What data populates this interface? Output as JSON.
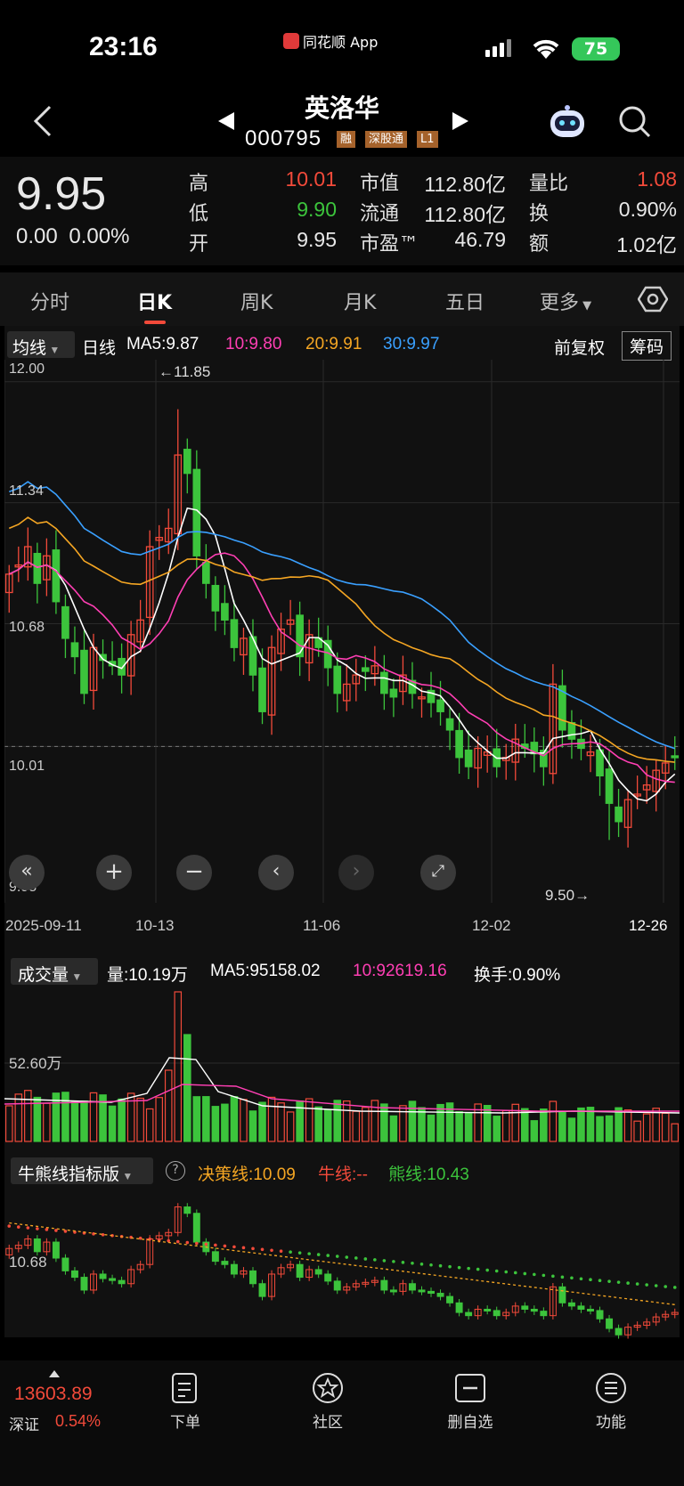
{
  "status_bar": {
    "time": "23:16",
    "app": "同花顺 App",
    "battery": "75"
  },
  "header": {
    "name": "英洛华",
    "code": "000795",
    "tags": [
      "融",
      "深股通",
      "L1"
    ]
  },
  "quote": {
    "price": "9.95",
    "change": "0.00",
    "change_pct": "0.00%",
    "high_label": "高",
    "high": "10.01",
    "low_label": "低",
    "low": "9.90",
    "open_label": "开",
    "open": "9.95",
    "mktcap_label": "市值",
    "mktcap": "112.80亿",
    "float_label": "流通",
    "float": "112.80亿",
    "pe_label": "市盈™",
    "pe": "46.79",
    "vr_label": "量比",
    "vr": "1.08",
    "turnover_label": "换",
    "turnover": "0.90%",
    "amount_label": "额",
    "amount": "1.02亿"
  },
  "tabs": [
    "分时",
    "日K",
    "周K",
    "月K",
    "五日",
    "更多"
  ],
  "ma_bar": {
    "selector": "均线",
    "period": "日线",
    "ma5": "MA5:9.87",
    "ma10": "10:9.80",
    "ma20": "20:9.91",
    "ma30": "30:9.97",
    "adjust": "前复权",
    "chips": "筹码"
  },
  "kline": {
    "y_labels": [
      "12.00",
      "11.34",
      "10.68",
      "10.01",
      "9.95"
    ],
    "max_label": "←11.85",
    "min_label": "9.50→",
    "x_labels": [
      "2025-09-11",
      "10-13",
      "11-06",
      "12-02",
      "12-26"
    ]
  },
  "volume_bar": {
    "selector": "成交量",
    "vol": "量:10.19万",
    "ma5": "MA5:95158.02",
    "ma10": "10:92619.16",
    "turnover": "换手:0.90%",
    "y_label": "52.60万"
  },
  "bull_bar": {
    "selector": "牛熊线指标版",
    "decision": "决策线:10.09",
    "bull": "牛线:--",
    "bear": "熊线:10.43",
    "y_label": "10.68"
  },
  "bottom_nav": {
    "index_value": "13603.89",
    "index_name": "深证",
    "index_pct": "0.54%",
    "items": [
      "下单",
      "社区",
      "删自选",
      "功能"
    ]
  },
  "colors": {
    "up": "#f24a3a",
    "down": "#3cc43c",
    "ma5": "#ffffff",
    "ma10": "#ff3fb4",
    "ma20": "#f5a623",
    "ma30": "#3aa0ff"
  }
}
